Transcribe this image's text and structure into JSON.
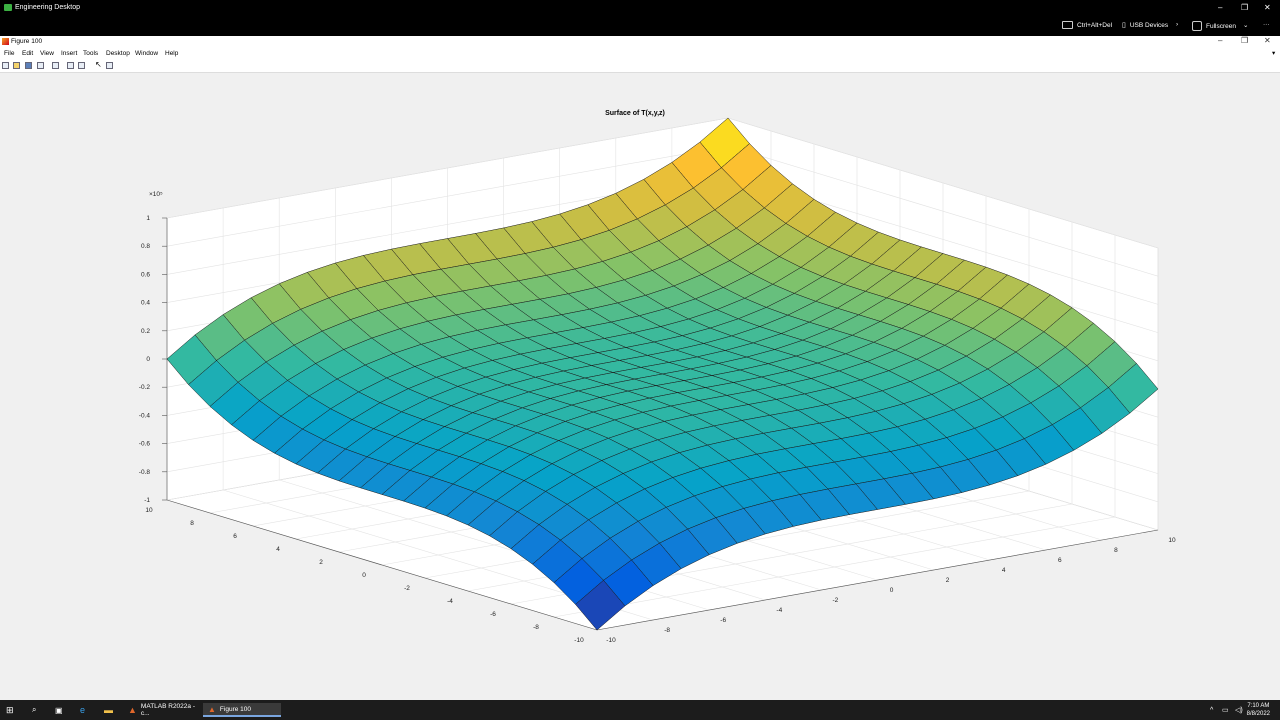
{
  "remote": {
    "title": "Engineering Desktop",
    "tools": [
      {
        "label": "Ctrl+Alt+Del",
        "icon": "keyboard-icon"
      },
      {
        "label": "USB Devices",
        "icon": "usb-icon"
      },
      {
        "label": "Fullscreen",
        "icon": "fullscreen-icon"
      }
    ],
    "minimize": "–",
    "restore": "❐",
    "close": "✕",
    "more": "···"
  },
  "figure": {
    "title": "Figure 100",
    "menus": [
      "File",
      "Edit",
      "View",
      "Insert",
      "Tools",
      "Desktop",
      "Window",
      "Help"
    ],
    "toolbar_icons": [
      "new-figure-icon",
      "open-file-icon",
      "save-icon",
      "print-icon",
      "print-preview-icon",
      "dock-icon",
      "property-editor-icon",
      "pointer-icon",
      "layout-icon"
    ]
  },
  "chart_data": {
    "type": "surface",
    "title": "Surface of T(x,y,z)",
    "z_exponent_label": "×10⁵",
    "z_ticks": [
      "1",
      "0.8",
      "0.6",
      "0.4",
      "0.2",
      "0",
      "-0.2",
      "-0.4",
      "-0.6",
      "-0.8",
      "-1"
    ],
    "x_ticks": [
      "-10",
      "-8",
      "-6",
      "-4",
      "-2",
      "0",
      "2",
      "4",
      "6",
      "8",
      "10"
    ],
    "y_ticks": [
      "10",
      "8",
      "6",
      "4",
      "2",
      "0",
      "-2",
      "-4",
      "-6",
      "-8",
      "-10"
    ],
    "x_range": [
      -10,
      10
    ],
    "y_range": [
      -10,
      10
    ],
    "z_range": [
      -100000,
      100000
    ],
    "grid": true,
    "colormap": "parula"
  },
  "taskbar": {
    "apps": [
      {
        "label": "MATLAB R2022a - c...",
        "icon": "matlab-icon"
      },
      {
        "label": "Figure 100",
        "icon": "figure-icon"
      }
    ],
    "time": "7:10 AM",
    "date": "8/8/2022"
  }
}
